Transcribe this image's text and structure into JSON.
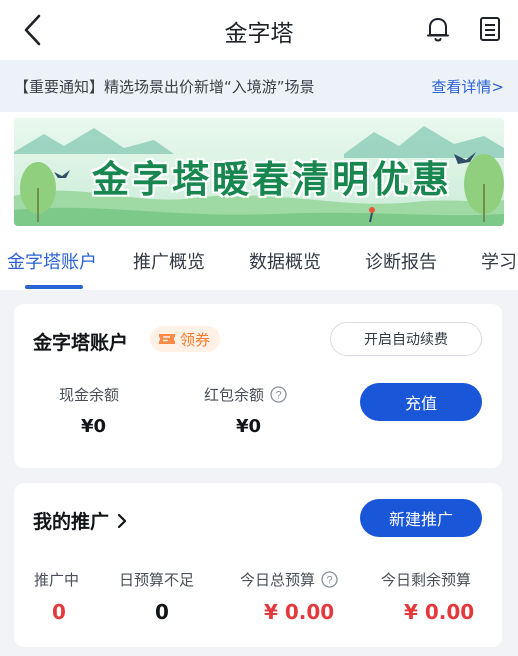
{
  "header": {
    "title": "金字塔",
    "back_icon": "chevron-left-icon",
    "bell_icon": "bell-icon",
    "doc_icon": "document-icon"
  },
  "notice": {
    "text": "【重要通知】精选场景出价新增“入境游”场景",
    "link": "查看详情>"
  },
  "banner": {
    "title": "金字塔暖春清明优惠"
  },
  "tabs": [
    {
      "label": "金字塔账户",
      "active": true
    },
    {
      "label": "推广概览",
      "active": false
    },
    {
      "label": "数据概览",
      "active": false
    },
    {
      "label": "诊断报告",
      "active": false
    },
    {
      "label": "学习",
      "active": false
    }
  ],
  "account": {
    "title": "金字塔账户",
    "coupon_label": "领券",
    "auto_renew_label": "开启自动续费",
    "cash_label": "现金余额",
    "cash_value": "¥0",
    "redpacket_label": "红包余额",
    "redpacket_value": "¥0",
    "recharge_label": "充值"
  },
  "promotion": {
    "title": "我的推广",
    "new_label": "新建推广",
    "stats": [
      {
        "label": "推广中",
        "value": "0"
      },
      {
        "label": "日预算不足",
        "value": "0"
      },
      {
        "label": "今日总预算",
        "value": "¥ 0.00"
      },
      {
        "label": "今日剩余预算",
        "value": "¥ 0.00"
      }
    ]
  },
  "colors": {
    "accent": "#1a57d8",
    "link": "#2b62d6",
    "value_red": "#e4393c",
    "coupon_orange": "#ff7a2e",
    "banner_green": "#17864f"
  }
}
